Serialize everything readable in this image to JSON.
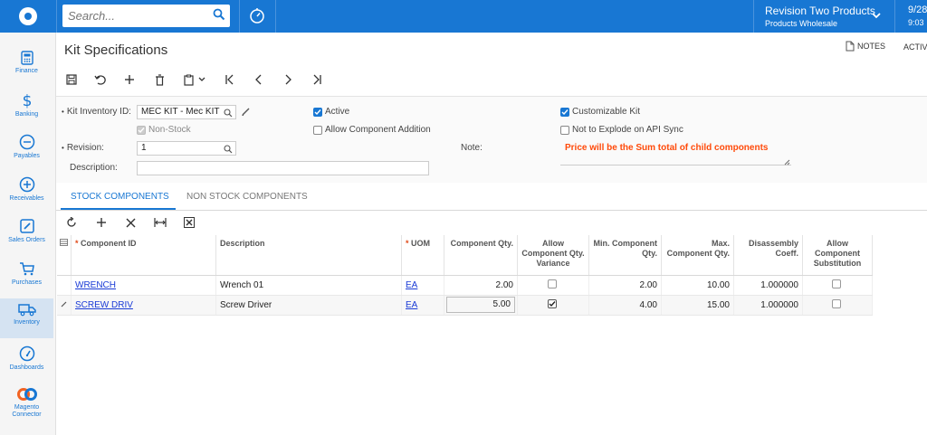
{
  "topbar": {
    "search_placeholder": "Search...",
    "company_name": "Revision Two Products",
    "company_branch": "Products Wholesale",
    "date": "9/28",
    "time": "9:03"
  },
  "sidebar": {
    "items": [
      {
        "label": "Finance",
        "icon": "calculator-icon"
      },
      {
        "label": "Banking",
        "icon": "dollar-icon"
      },
      {
        "label": "Payables",
        "icon": "minus-circle-icon"
      },
      {
        "label": "Receivables",
        "icon": "plus-circle-icon"
      },
      {
        "label": "Sales Orders",
        "icon": "pencil-icon"
      },
      {
        "label": "Purchases",
        "icon": "cart-icon"
      },
      {
        "label": "Inventory",
        "icon": "truck-icon"
      },
      {
        "label": "Dashboards",
        "icon": "gauge-icon"
      },
      {
        "label": "Magento Connector",
        "icon": "magento-icon"
      }
    ]
  },
  "page": {
    "title": "Kit Specifications",
    "notes_label": "NOTES",
    "activities_label": "ACTIV"
  },
  "form": {
    "kit_inventory_id_label": "Kit Inventory ID:",
    "kit_inventory_id_value": "MEC KIT - Mec KIT",
    "non_stock_label": "Non-Stock",
    "revision_label": "Revision:",
    "revision_value": "1",
    "description_label": "Description:",
    "description_value": "",
    "active_label": "Active",
    "allow_component_addition_label": "Allow Component Addition",
    "customizable_kit_label": "Customizable Kit",
    "not_to_explode_label": "Not to Explode on API Sync",
    "note_label": "Note:",
    "note_value": "Price will be the Sum total of child components"
  },
  "tabs": {
    "stock": "STOCK COMPONENTS",
    "non_stock": "NON STOCK COMPONENTS"
  },
  "grid": {
    "headers": {
      "component_id": "Component ID",
      "description": "Description",
      "uom": "UOM",
      "component_qty": "Component Qty.",
      "allow_variance": "Allow Component Qty. Variance",
      "min_qty": "Min. Component Qty.",
      "max_qty": "Max. Component Qty.",
      "disassembly": "Disassembly Coeff.",
      "allow_substitution": "Allow Component Substitution"
    },
    "rows": [
      {
        "component_id": "WRENCH",
        "description": "Wrench 01",
        "uom": "EA",
        "component_qty": "2.00",
        "allow_variance": false,
        "min_qty": "2.00",
        "max_qty": "10.00",
        "disassembly": "1.000000",
        "allow_substitution": false
      },
      {
        "component_id": "SCREW DRIV",
        "description": "Screw Driver",
        "uom": "EA",
        "component_qty": "5.00",
        "allow_variance": true,
        "min_qty": "4.00",
        "max_qty": "15.00",
        "disassembly": "1.000000",
        "allow_substitution": false
      }
    ]
  },
  "colors": {
    "brand": "#1877d3",
    "note_text": "#ff4a0a",
    "link": "#1a3bd6"
  }
}
